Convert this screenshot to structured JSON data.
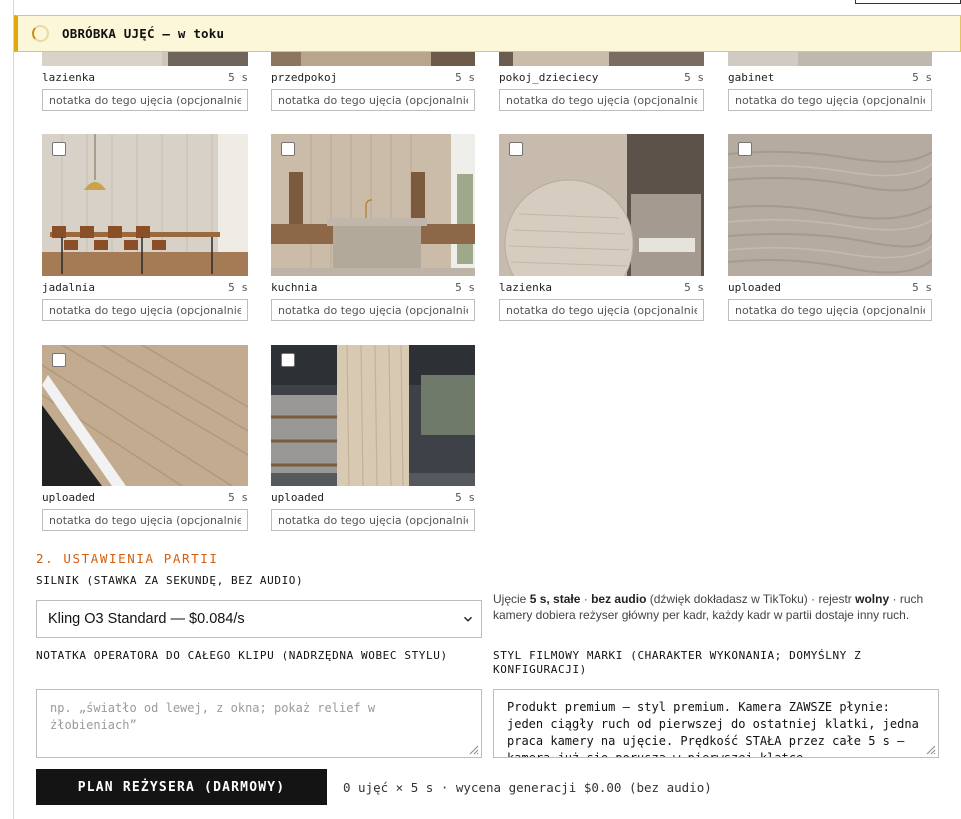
{
  "banner": {
    "title": "OBRÓBKA UJĘĆ — w toku"
  },
  "shots": [
    {
      "name": "lazienka",
      "duration": "5 s",
      "note_placeholder": "notatka do tego ujęcia (opcjonalnie)",
      "checked": false
    },
    {
      "name": "przedpokoj",
      "duration": "5 s",
      "note_placeholder": "notatka do tego ujęcia (opcjonalnie)",
      "checked": false
    },
    {
      "name": "pokoj_dzieciecy",
      "duration": "5 s",
      "note_placeholder": "notatka do tego ujęcia (opcjonalnie)",
      "checked": false
    },
    {
      "name": "gabinet",
      "duration": "5 s",
      "note_placeholder": "notatka do tego ujęcia (opcjonalnie)",
      "checked": false
    },
    {
      "name": "jadalnia",
      "duration": "5 s",
      "note_placeholder": "notatka do tego ujęcia (opcjonalnie)",
      "checked": false
    },
    {
      "name": "kuchnia",
      "duration": "5 s",
      "note_placeholder": "notatka do tego ujęcia (opcjonalnie)",
      "checked": false
    },
    {
      "name": "lazienka",
      "duration": "5 s",
      "note_placeholder": "notatka do tego ujęcia (opcjonalnie)",
      "checked": false
    },
    {
      "name": "uploaded",
      "duration": "5 s",
      "note_placeholder": "notatka do tego ujęcia (opcjonalnie)",
      "checked": false
    },
    {
      "name": "uploaded",
      "duration": "5 s",
      "note_placeholder": "notatka do tego ujęcia (opcjonalnie)",
      "checked": false
    },
    {
      "name": "uploaded",
      "duration": "5 s",
      "note_placeholder": "notatka do tego ujęcia (opcjonalnie)",
      "checked": false
    }
  ],
  "settings": {
    "heading": "2. USTAWIENIA PARTII",
    "engine_label": "SILNIK (STAWKA ZA SEKUNDĘ, BEZ AUDIO)",
    "engine_value": "Kling O3 Standard — $0.084/s",
    "info": {
      "p1": "Ujęcie ",
      "b1": "5 s, stałe",
      "p2": " · ",
      "b2": "bez audio",
      "p3": " (dźwięk dokładasz w TikToku) · rejestr ",
      "b3": "wolny",
      "p4": " · ruch kamery dobiera reżyser główny per kadr, każdy kadr w partii dostaje inny ruch."
    },
    "operator_note_label": "NOTATKA OPERATORA DO CAŁEGO KLIPU (NADRZĘDNA WOBEC STYLU)",
    "operator_note_placeholder": "np. „światło od lewej, z okna; pokaż relief w żłobieniach”",
    "brand_style_label": "STYL FILMOWY MARKI (CHARAKTER WYKONANIA; DOMYŚLNY Z KONFIGURACJI)",
    "brand_style_value": "Produkt premium — styl premium. Kamera ZAWSZE płynie: jeden ciągły ruch od pierwszej do ostatniej klatki, jedna praca kamery na ujęcie. Prędkość STAŁA przez całe 5 s — kamera już się porusza w pierwszej klatce"
  },
  "footer": {
    "plan_button": "PLAN REŻYSERA (DARMOWY)",
    "summary": "0 ujęć × 5 s · wycena generacji $0.00 (bez audio)"
  },
  "icons": {
    "banner": "spinner-icon",
    "select": "chevron-down-icon",
    "resize": "resize-grip-icon"
  },
  "colors": {
    "accent": "#d35f0f",
    "banner_bg": "#fdf7da",
    "banner_border": "#e0aa0c",
    "button_bg": "#141414"
  }
}
